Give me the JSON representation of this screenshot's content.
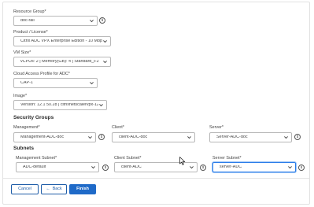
{
  "form": {
    "resource_group": {
      "label": "Resource Group*",
      "value": "doc-rail"
    },
    "product": {
      "label": "Product / License*",
      "value": "Citrix ADC VPX Enterprise Edition - 10 Mbps ( ..."
    },
    "vm_size": {
      "label": "VM Size*",
      "value": "vCPUs: 2 | Memory(GB): 4 | Standard_F2"
    },
    "cloud_access_profile": {
      "label": "Cloud Access Profile for ADC*",
      "value": "CAP-1"
    },
    "image": {
      "label": "Image*",
      "value": "Version: 12.1 50.28 | citrixnetscalervpx-121"
    }
  },
  "security_groups": {
    "heading": "Security Groups",
    "management": {
      "label": "Management*",
      "value": "Management-ADC-doc"
    },
    "client": {
      "label": "Client*",
      "value": "client-ADC-doc"
    },
    "server": {
      "label": "Server*",
      "value": "Server-ADC-doc"
    }
  },
  "subnets": {
    "heading": "Subnets",
    "management": {
      "label": "Management Subnet*",
      "value": "ADC-default"
    },
    "client": {
      "label": "Client Subnet*",
      "value": "client-ADC"
    },
    "server": {
      "label": "Server Subnet*",
      "value": "server-ADC"
    }
  },
  "info_glyph": "i",
  "buttons": {
    "cancel": "Cancel",
    "back": "Back",
    "back_arrow": "←",
    "finish": "Finish"
  },
  "colors": {
    "primary": "#1f6ac8",
    "focus": "#2b7de9"
  },
  "icons": [
    "chevron-down-icon",
    "info-icon",
    "back-arrow-icon",
    "mouse-cursor-icon"
  ]
}
